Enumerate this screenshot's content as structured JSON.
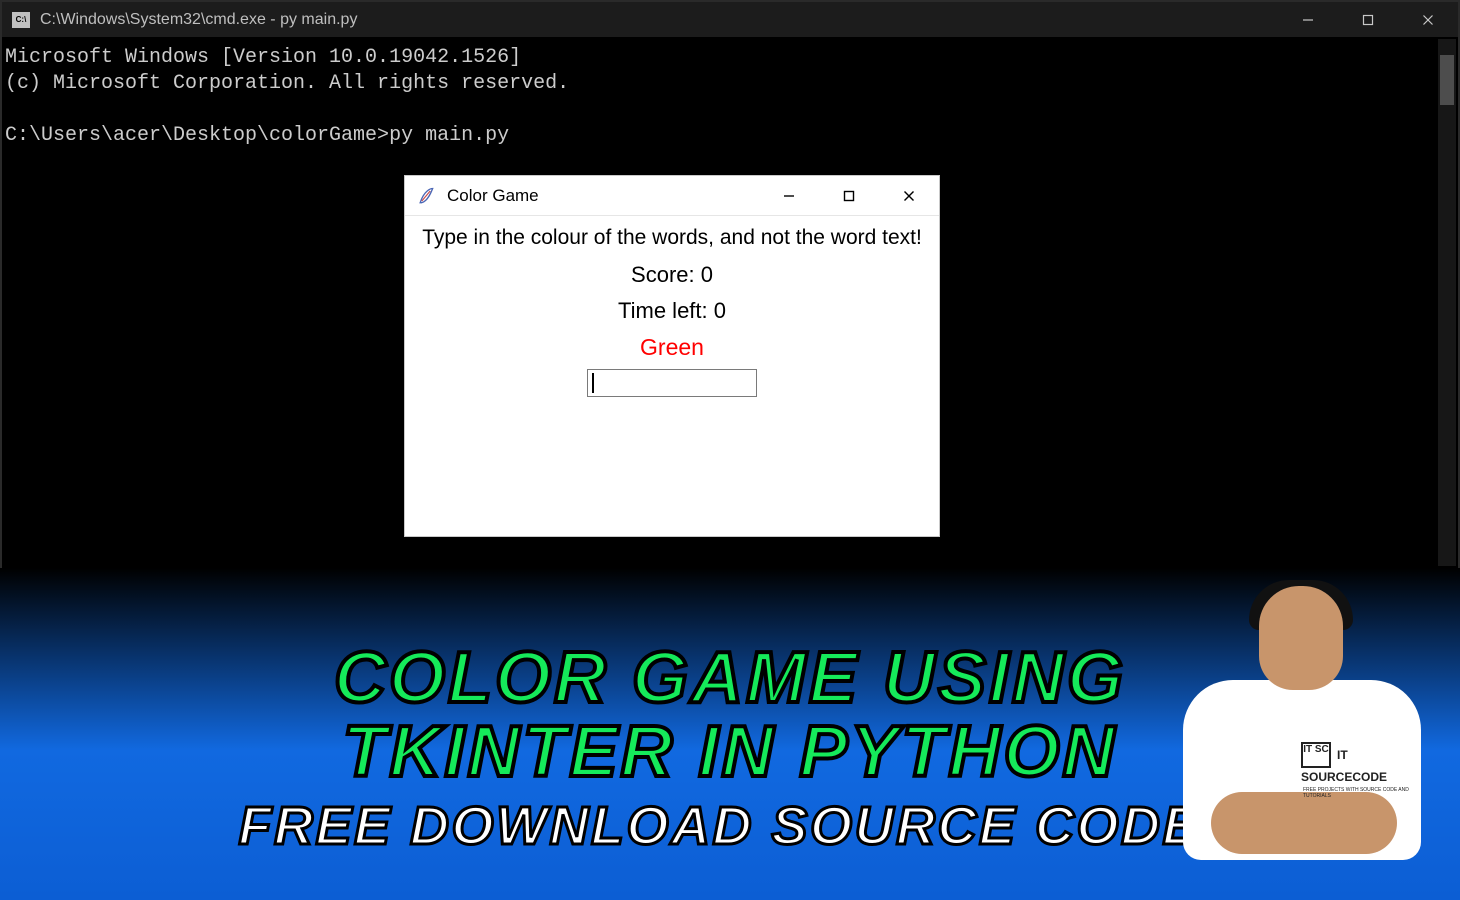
{
  "cmd": {
    "title": "C:\\Windows\\System32\\cmd.exe - py  main.py",
    "body_line1": "Microsoft Windows [Version 10.0.19042.1526]",
    "body_line2": "(c) Microsoft Corporation. All rights reserved.",
    "body_line3": "",
    "body_line4": "C:\\Users\\acer\\Desktop\\colorGame>py main.py"
  },
  "tk": {
    "title": "Color Game",
    "instruction": "Type in the colour of the words, and not the word text!",
    "score_label": "Score: 0",
    "time_label": "Time left: 0",
    "word": "Green",
    "word_color": "#ff0000",
    "entry_value": ""
  },
  "banner": {
    "headline_line1": "COLOR GAME USING",
    "headline_line2": "TKINTER IN PYTHON",
    "subline": "FREE DOWNLOAD SOURCE CODE!"
  },
  "person_logo": {
    "glyph": "IT\nSC",
    "text": "IT SOURCECODE",
    "sub": "FREE PROJECTS WITH SOURCE CODE AND TUTORIALS"
  },
  "icons": {
    "cmd": "cmd-icon",
    "feather": "feather-icon",
    "minimize": "minimize-icon",
    "maximize": "maximize-icon",
    "close": "close-icon"
  }
}
